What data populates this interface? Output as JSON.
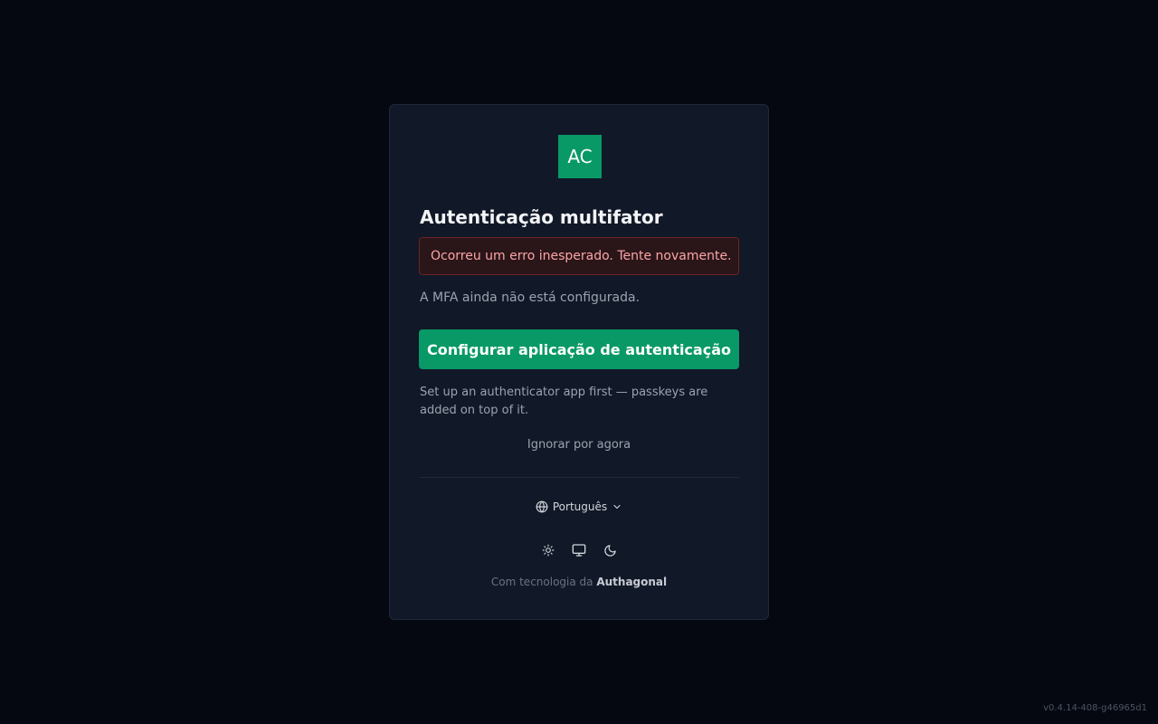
{
  "logo": {
    "text": "AC",
    "color": "#089966"
  },
  "title": "Autenticação multifator",
  "alert": {
    "message": "Ocorreu um erro inesperado. Tente novamente.",
    "color": "#fca5a5"
  },
  "status": "A MFA ainda não está configurada.",
  "primary_button": {
    "label": "Configurar aplicação de autenticação",
    "color": "#089966"
  },
  "hint": "Set up an authenticator app first — passkeys are added on top of it.",
  "skip_link": "Ignorar por agora",
  "language": {
    "selected": "Português",
    "icon": "globe-icon",
    "dropdown_icon": "chevron-down-icon"
  },
  "theme_options": [
    {
      "icon": "sun-icon",
      "value": "light"
    },
    {
      "icon": "monitor-icon",
      "value": "system"
    },
    {
      "icon": "moon-icon",
      "value": "dark"
    }
  ],
  "footer": {
    "prefix": "Com tecnologia da",
    "brand": "Authagonal"
  },
  "version": "v0.4.14-408-g46965d1"
}
